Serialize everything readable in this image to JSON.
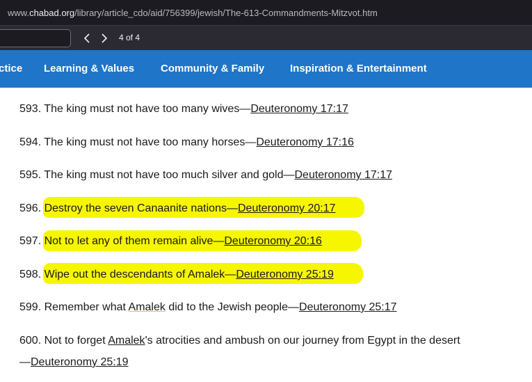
{
  "address_bar": {
    "prefix": "www.",
    "domain": "chabad.org",
    "path": "/library/article_cdo/aid/756399/jewish/The-613-Commandments-Mitzvot.htm"
  },
  "find_bar": {
    "input_value": "",
    "match_count": "4 of 4"
  },
  "nav": {
    "items": [
      "ctice",
      "Learning & Values",
      "Community & Family",
      "Inspiration & Entertainment"
    ],
    "color": "#1f75c7"
  },
  "highlight_color": "#f6f600",
  "commandments": [
    {
      "num": "593.",
      "text": "The king must not have too many wives—",
      "ref": "Deuteronomy 17:17"
    },
    {
      "num": "594.",
      "text": "The king must not have too many horses—",
      "ref": "Deuteronomy 17:16"
    },
    {
      "num": "595.",
      "text": "The king must not have too much silver and gold—",
      "ref": "Deuteronomy 17:17"
    },
    {
      "num": "596.",
      "text": "Destroy the seven Canaanite nations—",
      "ref": "Deuteronomy 20:17"
    },
    {
      "num": "597.",
      "text": "Not to let any of them remain alive—",
      "ref": "Deuteronomy 20:16"
    },
    {
      "num": "598.",
      "text": "Wipe out the descendants of Amalek—",
      "ref": "Deuteronomy 25:19"
    },
    {
      "num": "599.",
      "text_before": "Remember what ",
      "link": "Amalek",
      "text_after": " did to the Jewish people—",
      "ref": "Deuteronomy 25:17"
    },
    {
      "num": "600.",
      "text_before": "Not to forget ",
      "link": "Amalek",
      "text_after": "'s atrocities and ambush on our journey from Egypt in the desert",
      "line2_prefix": "—",
      "ref": "Deuteronomy 25:19"
    }
  ]
}
